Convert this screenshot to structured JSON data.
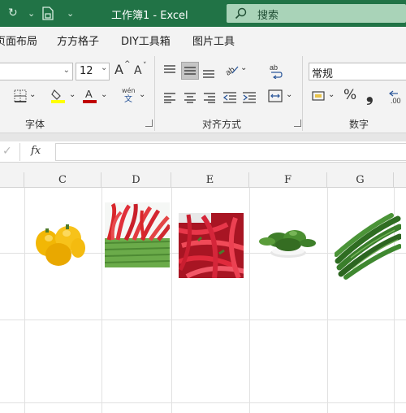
{
  "titlebar": {
    "title": "工作簿1  -  Excel",
    "search_label": "搜索",
    "qa_redo": "↻",
    "qa_dropdown": "⌄",
    "qa_more": "⌄",
    "color": "#217346"
  },
  "menu": {
    "items": [
      "页面布局",
      "方方格子",
      "DIY工具箱",
      "图片工具"
    ]
  },
  "ribbon": {
    "font_size": "12",
    "number_format": "常规",
    "groups": {
      "font": "字体",
      "alignment": "对齐方式",
      "number": "数字"
    },
    "icons": {
      "grow_font": "A",
      "shrink_font": "A",
      "wen": "wén",
      "wen2": "文",
      "percent": "%",
      "comma": "❟"
    }
  },
  "formula_bar": {
    "fx": "fx",
    "check": "✓",
    "value": ""
  },
  "columns": [
    "C",
    "D",
    "E",
    "F",
    "G"
  ],
  "images": [
    {
      "name": "yellow-peppers",
      "col": "C"
    },
    {
      "name": "red-chilies-bunch",
      "col": "D"
    },
    {
      "name": "red-chilies-pile",
      "col": "E"
    },
    {
      "name": "green-peppers-bowl",
      "col": "F"
    },
    {
      "name": "green-chilies",
      "col": "G"
    }
  ]
}
